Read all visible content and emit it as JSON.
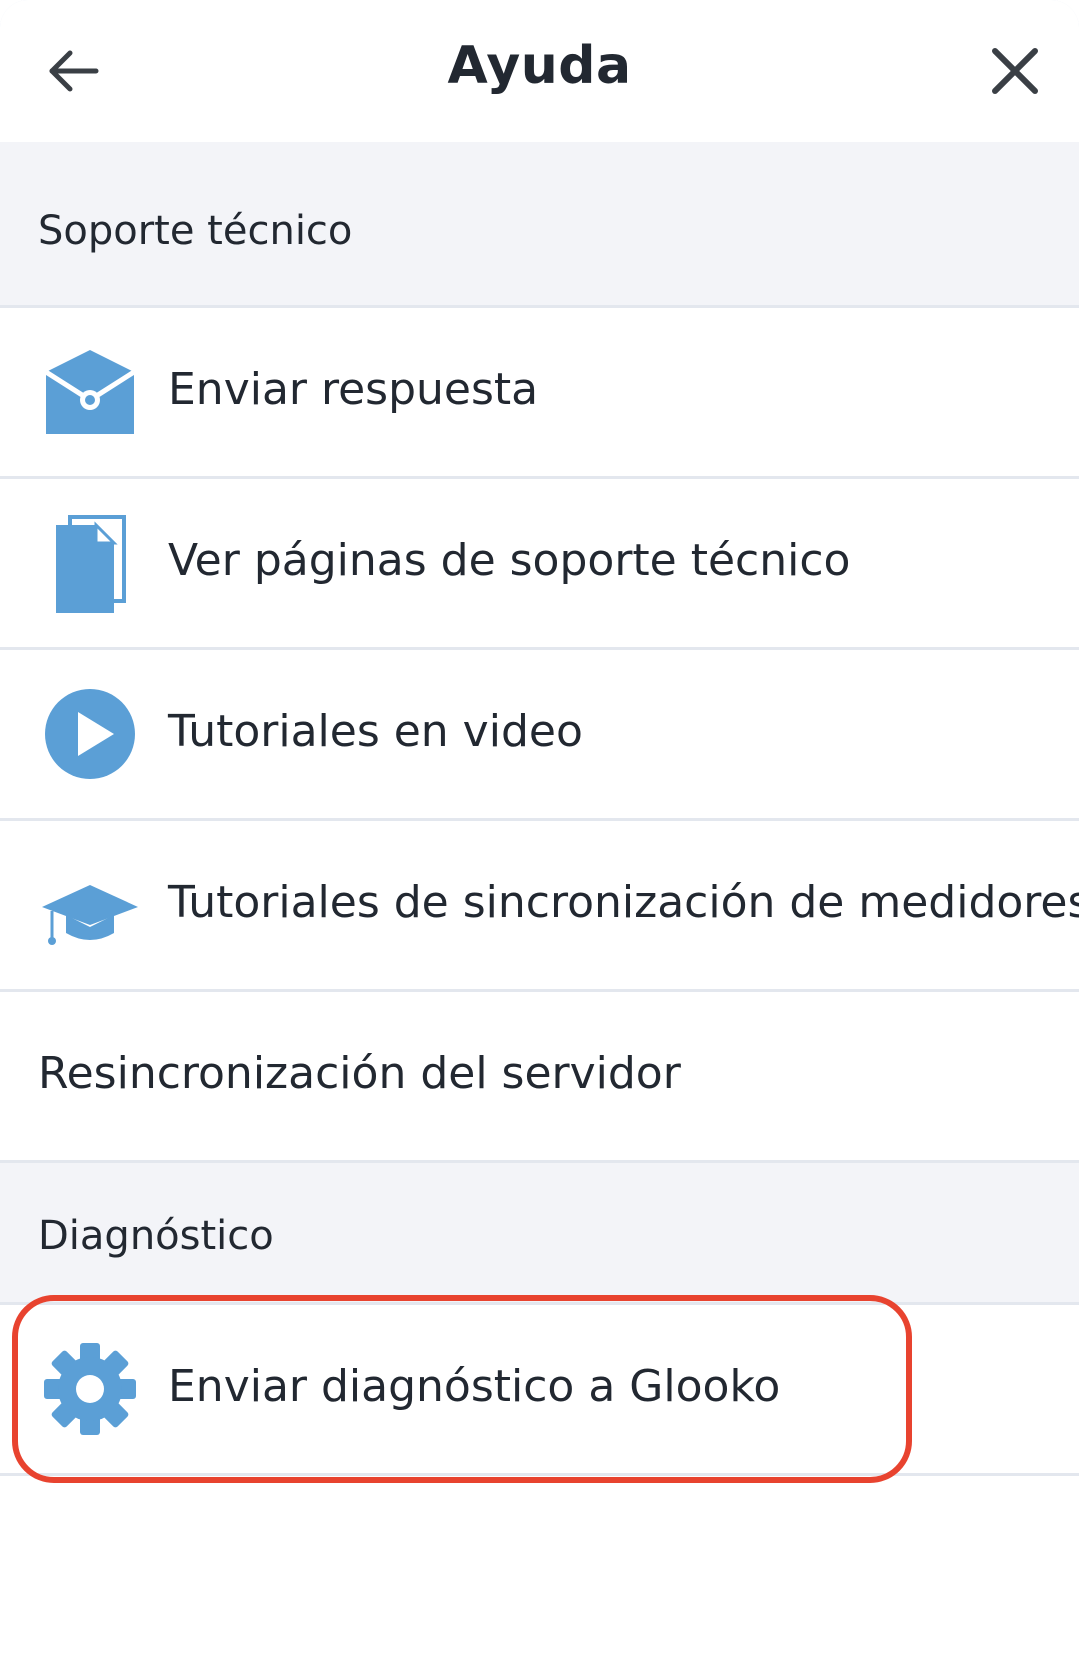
{
  "header": {
    "title": "Ayuda",
    "back_icon": "arrow-left-icon",
    "close_icon": "close-icon"
  },
  "sections": {
    "support": {
      "title": "Soporte técnico",
      "items": [
        {
          "label": "Enviar respuesta",
          "icon": "envelope-icon"
        },
        {
          "label": "Ver páginas de soporte técnico",
          "icon": "document-icon"
        },
        {
          "label": "Tutoriales en video",
          "icon": "play-icon"
        },
        {
          "label": "Tutoriales de sincronización de medidores",
          "icon": "graduation-cap-icon"
        },
        {
          "label": "Resincronización del servidor",
          "icon": ""
        }
      ]
    },
    "diagnostics": {
      "title": "Diagnóstico",
      "items": [
        {
          "label": "Enviar diagnóstico a Glooko",
          "icon": "gear-icon"
        }
      ]
    }
  },
  "colors": {
    "icon_blue": "#5b9fd6",
    "section_bg": "#f3f4f8",
    "divider": "#e3e7ee",
    "text": "#222831",
    "highlight": "#e8432f"
  }
}
